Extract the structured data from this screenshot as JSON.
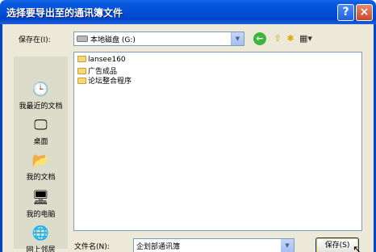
{
  "window": {
    "title": "选择要导出至的通讯簿文件",
    "help_button": "?",
    "close_button": "×"
  },
  "toolbar": {
    "save_in_label": "保存在(I):",
    "location": "本地磁盘 (G:)"
  },
  "places": [
    {
      "label": "我最近的文档",
      "icon": "recent-documents-icon"
    },
    {
      "label": "桌面",
      "icon": "desktop-icon"
    },
    {
      "label": "我的文档",
      "icon": "my-documents-icon"
    },
    {
      "label": "我的电脑",
      "icon": "my-computer-icon"
    },
    {
      "label": "网上邻居",
      "icon": "network-places-icon"
    }
  ],
  "files": [
    {
      "name": "lansee160",
      "icon": "folder-icon"
    },
    {
      "name": "广告成品",
      "icon": "folder-icon"
    },
    {
      "name": "论坛整合程序",
      "icon": "folder-icon"
    }
  ],
  "filename": {
    "label": "文件名(N):",
    "value": "企划部通讯簿"
  },
  "buttons": {
    "save": "保存(S)"
  }
}
